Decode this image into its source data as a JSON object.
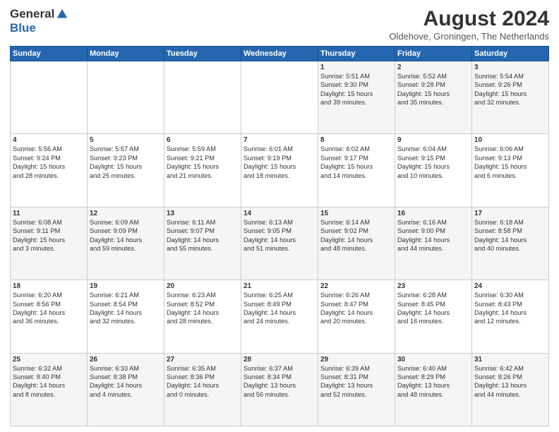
{
  "header": {
    "logo_general": "General",
    "logo_blue": "Blue",
    "month_title": "August 2024",
    "location": "Oldehove, Groningen, The Netherlands"
  },
  "calendar": {
    "headers": [
      "Sunday",
      "Monday",
      "Tuesday",
      "Wednesday",
      "Thursday",
      "Friday",
      "Saturday"
    ],
    "rows": [
      [
        {
          "day": "",
          "info": ""
        },
        {
          "day": "",
          "info": ""
        },
        {
          "day": "",
          "info": ""
        },
        {
          "day": "",
          "info": ""
        },
        {
          "day": "1",
          "info": "Sunrise: 5:51 AM\nSunset: 9:30 PM\nDaylight: 15 hours\nand 39 minutes."
        },
        {
          "day": "2",
          "info": "Sunrise: 5:52 AM\nSunset: 9:28 PM\nDaylight: 15 hours\nand 35 minutes."
        },
        {
          "day": "3",
          "info": "Sunrise: 5:54 AM\nSunset: 9:26 PM\nDaylight: 15 hours\nand 32 minutes."
        }
      ],
      [
        {
          "day": "4",
          "info": "Sunrise: 5:56 AM\nSunset: 9:24 PM\nDaylight: 15 hours\nand 28 minutes."
        },
        {
          "day": "5",
          "info": "Sunrise: 5:57 AM\nSunset: 9:23 PM\nDaylight: 15 hours\nand 25 minutes."
        },
        {
          "day": "6",
          "info": "Sunrise: 5:59 AM\nSunset: 9:21 PM\nDaylight: 15 hours\nand 21 minutes."
        },
        {
          "day": "7",
          "info": "Sunrise: 6:01 AM\nSunset: 9:19 PM\nDaylight: 15 hours\nand 18 minutes."
        },
        {
          "day": "8",
          "info": "Sunrise: 6:02 AM\nSunset: 9:17 PM\nDaylight: 15 hours\nand 14 minutes."
        },
        {
          "day": "9",
          "info": "Sunrise: 6:04 AM\nSunset: 9:15 PM\nDaylight: 15 hours\nand 10 minutes."
        },
        {
          "day": "10",
          "info": "Sunrise: 6:06 AM\nSunset: 9:13 PM\nDaylight: 15 hours\nand 6 minutes."
        }
      ],
      [
        {
          "day": "11",
          "info": "Sunrise: 6:08 AM\nSunset: 9:11 PM\nDaylight: 15 hours\nand 3 minutes."
        },
        {
          "day": "12",
          "info": "Sunrise: 6:09 AM\nSunset: 9:09 PM\nDaylight: 14 hours\nand 59 minutes."
        },
        {
          "day": "13",
          "info": "Sunrise: 6:11 AM\nSunset: 9:07 PM\nDaylight: 14 hours\nand 55 minutes."
        },
        {
          "day": "14",
          "info": "Sunrise: 6:13 AM\nSunset: 9:05 PM\nDaylight: 14 hours\nand 51 minutes."
        },
        {
          "day": "15",
          "info": "Sunrise: 6:14 AM\nSunset: 9:02 PM\nDaylight: 14 hours\nand 48 minutes."
        },
        {
          "day": "16",
          "info": "Sunrise: 6:16 AM\nSunset: 9:00 PM\nDaylight: 14 hours\nand 44 minutes."
        },
        {
          "day": "17",
          "info": "Sunrise: 6:18 AM\nSunset: 8:58 PM\nDaylight: 14 hours\nand 40 minutes."
        }
      ],
      [
        {
          "day": "18",
          "info": "Sunrise: 6:20 AM\nSunset: 8:56 PM\nDaylight: 14 hours\nand 36 minutes."
        },
        {
          "day": "19",
          "info": "Sunrise: 6:21 AM\nSunset: 8:54 PM\nDaylight: 14 hours\nand 32 minutes."
        },
        {
          "day": "20",
          "info": "Sunrise: 6:23 AM\nSunset: 8:52 PM\nDaylight: 14 hours\nand 28 minutes."
        },
        {
          "day": "21",
          "info": "Sunrise: 6:25 AM\nSunset: 8:49 PM\nDaylight: 14 hours\nand 24 minutes."
        },
        {
          "day": "22",
          "info": "Sunrise: 6:26 AM\nSunset: 8:47 PM\nDaylight: 14 hours\nand 20 minutes."
        },
        {
          "day": "23",
          "info": "Sunrise: 6:28 AM\nSunset: 8:45 PM\nDaylight: 14 hours\nand 16 minutes."
        },
        {
          "day": "24",
          "info": "Sunrise: 6:30 AM\nSunset: 8:43 PM\nDaylight: 14 hours\nand 12 minutes."
        }
      ],
      [
        {
          "day": "25",
          "info": "Sunrise: 6:32 AM\nSunset: 8:40 PM\nDaylight: 14 hours\nand 8 minutes."
        },
        {
          "day": "26",
          "info": "Sunrise: 6:33 AM\nSunset: 8:38 PM\nDaylight: 14 hours\nand 4 minutes."
        },
        {
          "day": "27",
          "info": "Sunrise: 6:35 AM\nSunset: 8:36 PM\nDaylight: 14 hours\nand 0 minutes."
        },
        {
          "day": "28",
          "info": "Sunrise: 6:37 AM\nSunset: 8:34 PM\nDaylight: 13 hours\nand 56 minutes."
        },
        {
          "day": "29",
          "info": "Sunrise: 6:39 AM\nSunset: 8:31 PM\nDaylight: 13 hours\nand 52 minutes."
        },
        {
          "day": "30",
          "info": "Sunrise: 6:40 AM\nSunset: 8:29 PM\nDaylight: 13 hours\nand 48 minutes."
        },
        {
          "day": "31",
          "info": "Sunrise: 6:42 AM\nSunset: 8:26 PM\nDaylight: 13 hours\nand 44 minutes."
        }
      ]
    ]
  }
}
